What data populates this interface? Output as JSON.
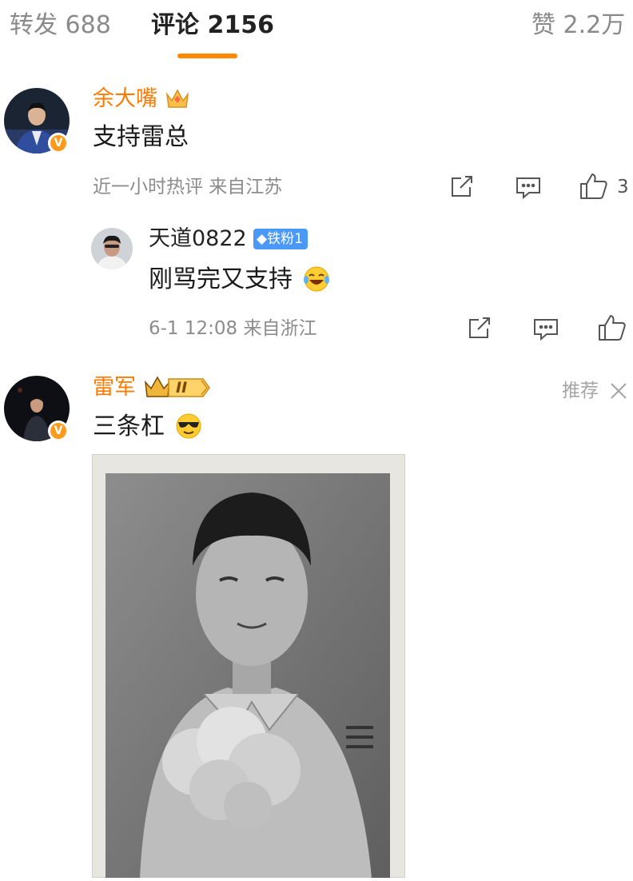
{
  "tabs": {
    "reposts": "转发 688",
    "comments": "评论 2156",
    "likes": "赞 2.2万"
  },
  "comments": [
    {
      "username": "余大嘴",
      "verified_badge": "V",
      "text": "支持雷总",
      "meta": "近一小时热评  来自江苏",
      "like_count": "3",
      "reply": {
        "username": "天道0822",
        "fan_badge": "铁粉1",
        "text": "刚骂完又支持",
        "text_emoji": "laughing-tears-emoji",
        "meta": "6-1 12:08  来自浙江"
      }
    },
    {
      "username": "雷军",
      "verified_badge": "V",
      "level_badge": "II",
      "text": "三条杠",
      "text_emoji": "sunglasses-emoji",
      "recommend_label": "推荐",
      "photo": "black-and-white-childhood-portrait"
    }
  ],
  "colors": {
    "accent": "#ff8a00",
    "username_orange": "#ff7a00",
    "fan_badge_blue": "#4a98f7",
    "meta_grey": "#8c8c8c"
  }
}
